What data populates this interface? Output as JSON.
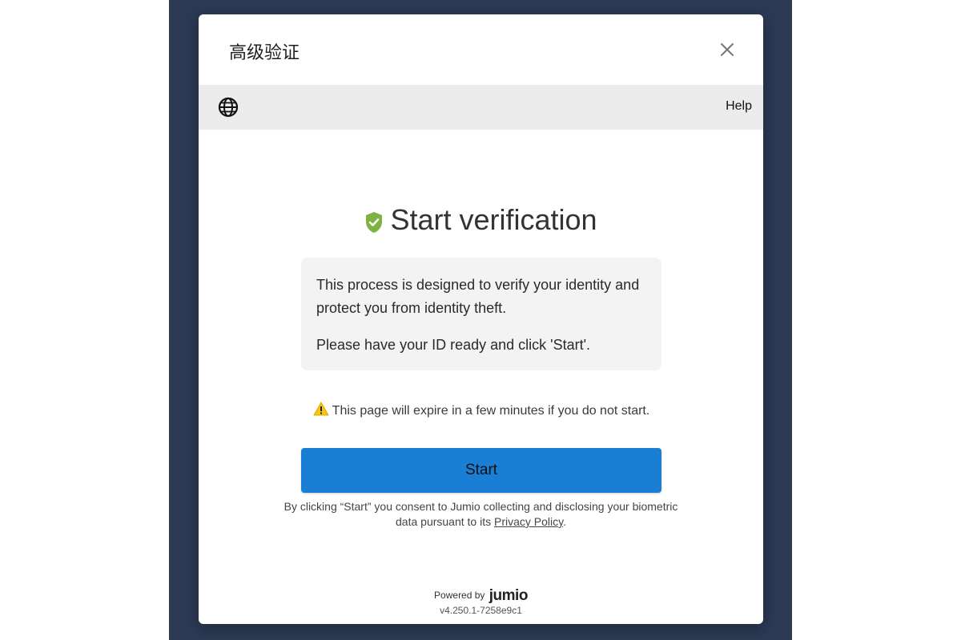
{
  "modal": {
    "title": "高级验证"
  },
  "toolbar": {
    "help_label": "Help"
  },
  "content": {
    "heading": "Start verification",
    "info_line1": "This process is designed to verify your identity and protect you from identity theft.",
    "info_line2": "Please have your ID ready and click 'Start'.",
    "warning": "This page will expire in a few minutes if you do not start.",
    "start_label": "Start",
    "consent_prefix": "By clicking “Start” you consent to Jumio collecting and disclosing your biometric data pursuant to its",
    "privacy_link": "Privacy Policy",
    "consent_suffix": "."
  },
  "footer": {
    "powered_by": "Powered by",
    "brand": "jumio",
    "version": "v4.250.1-7258e9c1"
  },
  "icons": {
    "close": "close-icon",
    "globe": "globe-icon",
    "shield": "shield-check-icon",
    "warning": "warning-icon"
  },
  "colors": {
    "backdrop": "#2d3a55",
    "toolbar": "#ececec",
    "accent_button": "#1a7fd4",
    "shield_green": "#7cb342",
    "warning_yellow": "#f5c518"
  }
}
